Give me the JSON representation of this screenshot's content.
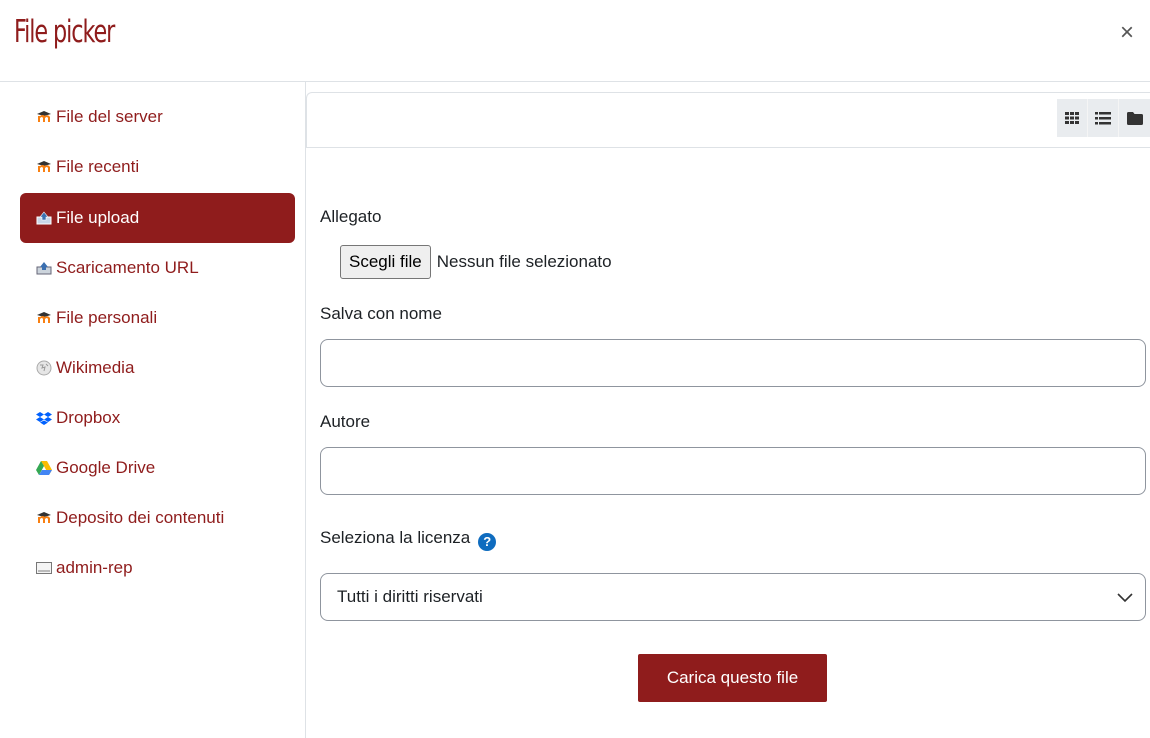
{
  "header": {
    "title": "File picker",
    "close_symbol": "×"
  },
  "sidebar": {
    "items": [
      {
        "label": "File del server",
        "icon": "moodle-icon",
        "active": false
      },
      {
        "label": "File recenti",
        "icon": "moodle-icon",
        "active": false
      },
      {
        "label": "File upload",
        "icon": "upload-icon",
        "active": true
      },
      {
        "label": "Scaricamento URL",
        "icon": "url-download-icon",
        "active": false
      },
      {
        "label": "File personali",
        "icon": "moodle-icon",
        "active": false
      },
      {
        "label": "Wikimedia",
        "icon": "wikimedia-icon",
        "active": false
      },
      {
        "label": "Dropbox",
        "icon": "dropbox-icon",
        "active": false
      },
      {
        "label": "Google Drive",
        "icon": "google-drive-icon",
        "active": false
      },
      {
        "label": "Deposito dei contenuti",
        "icon": "moodle-icon",
        "active": false
      },
      {
        "label": "admin-rep",
        "icon": "repository-icon",
        "active": false
      }
    ]
  },
  "toolbar": {
    "view_buttons": [
      "grid-view-icon",
      "list-view-icon",
      "folder-view-icon"
    ]
  },
  "form": {
    "attachment_label": "Allegato",
    "choose_file_label": "Scegli file",
    "no_file_text": "Nessun file selezionato",
    "save_as_label": "Salva con nome",
    "save_as_value": "",
    "author_label": "Autore",
    "author_value": "",
    "license_label": "Seleziona la licenza",
    "license_value": "Tutti i diritti riservati",
    "upload_button": "Carica questo file"
  },
  "colors": {
    "accent": "#8f1c1c",
    "help": "#0f6cbf"
  }
}
